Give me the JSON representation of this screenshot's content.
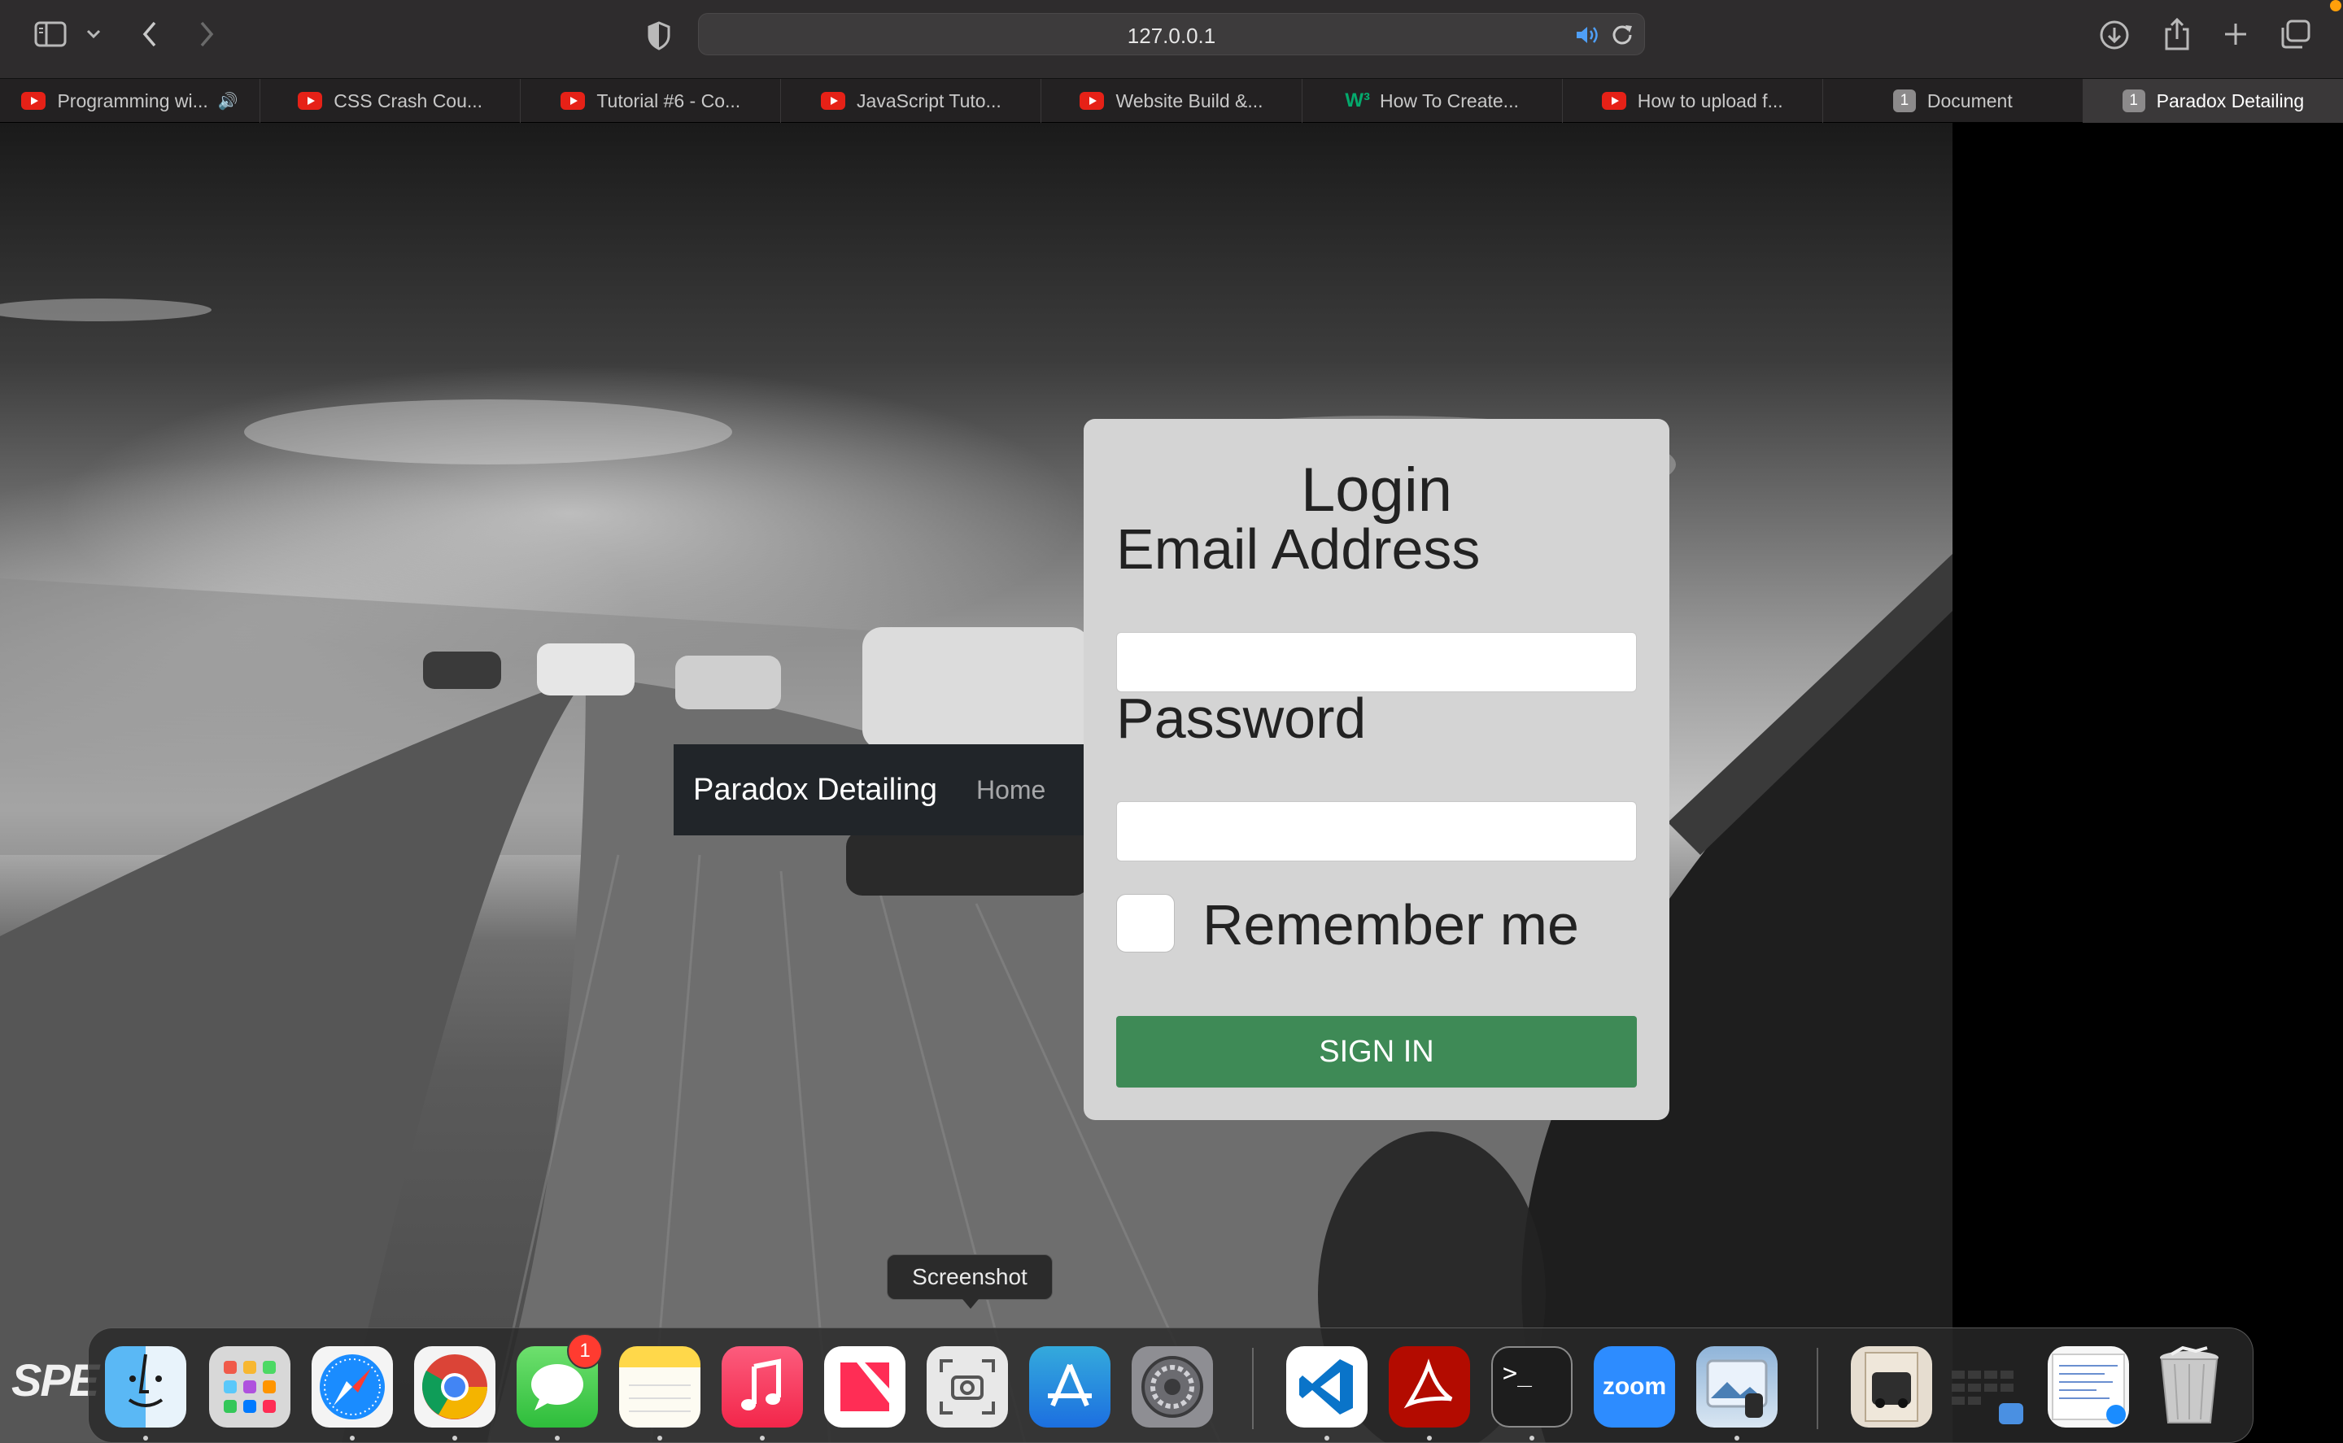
{
  "browser": {
    "url": "127.0.0.1",
    "tabs": [
      {
        "label": "Programming wi...",
        "icon": "youtube-icon",
        "audio": true
      },
      {
        "label": "CSS Crash Cou...",
        "icon": "youtube-icon"
      },
      {
        "label": "Tutorial #6 - Co...",
        "icon": "youtube-icon"
      },
      {
        "label": "JavaScript Tuto...",
        "icon": "youtube-icon"
      },
      {
        "label": "Website Build &...",
        "icon": "youtube-icon"
      },
      {
        "label": "How To Create...",
        "icon": "w3schools-icon"
      },
      {
        "label": "How to upload f...",
        "icon": "youtube-icon"
      },
      {
        "label": "Document",
        "icon": "page-number-icon",
        "badge": "1"
      },
      {
        "label": "Paradox Detailing",
        "icon": "page-number-icon",
        "badge": "1",
        "active": true
      }
    ]
  },
  "navbar": {
    "brand": "Paradox Detailing",
    "home": "Home"
  },
  "login": {
    "title": "Login",
    "email_label": "Email Address",
    "email_value": "",
    "password_label": "Password",
    "password_value": "",
    "remember_label": "Remember me",
    "remember_checked": false,
    "submit_label": "SIGN IN"
  },
  "tooltip": "Screenshot",
  "dock": {
    "spe_logo": "SPE",
    "messages_badge": "1",
    "zoom_label": "zoom",
    "terminal_prompt": ">_",
    "items": [
      "finder",
      "launchpad",
      "safari",
      "chrome",
      "messages",
      "notes",
      "music",
      "news",
      "screenshot",
      "app-store",
      "system-settings",
      "vscode",
      "acrobat",
      "terminal",
      "zoom",
      "preview",
      "photo-stack",
      "grid-stack",
      "document-stack",
      "trash"
    ]
  },
  "colors": {
    "signin_button": "#3e8a56",
    "navbar_bg": "#212529",
    "card_bg": "#d4d4d4"
  }
}
